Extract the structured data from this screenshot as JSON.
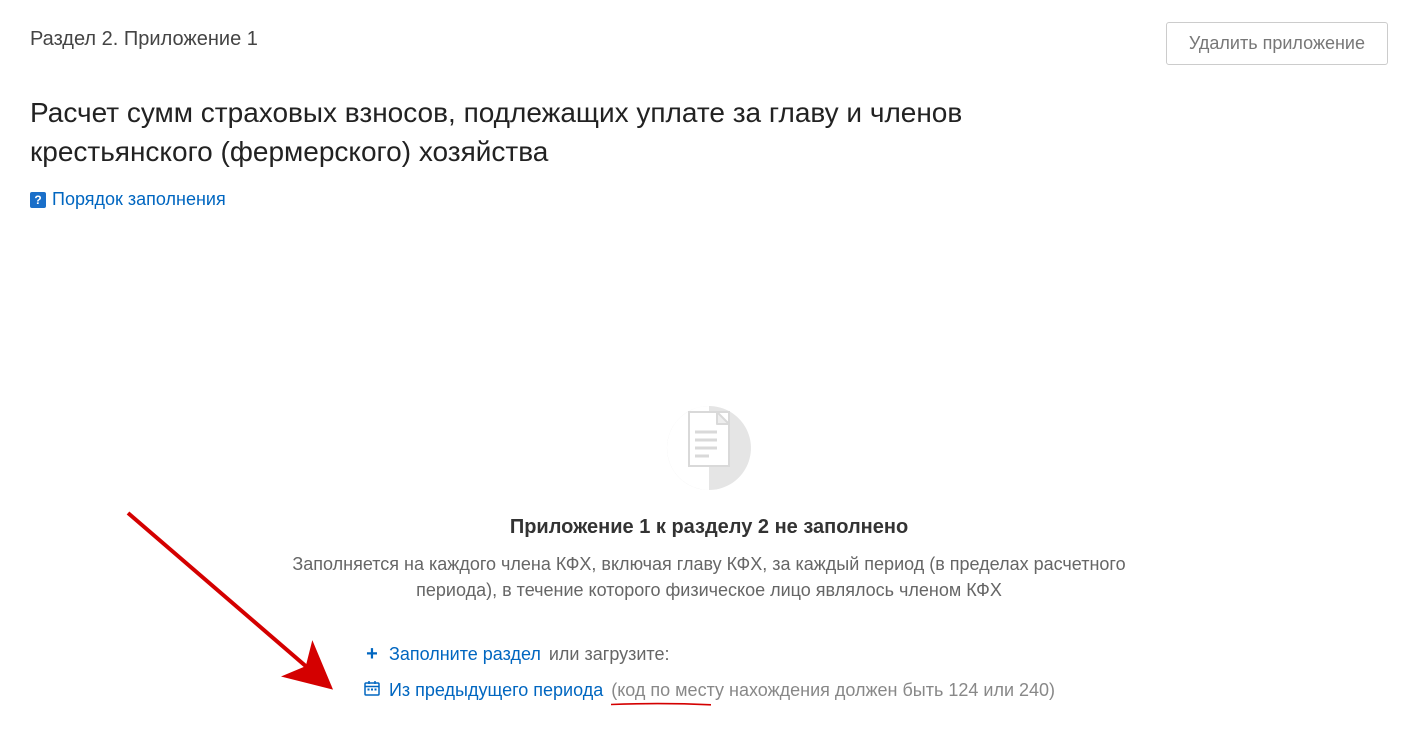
{
  "header": {
    "section_label": "Раздел 2. Приложение 1",
    "delete_button": "Удалить приложение",
    "title": "Расчет сумм страховых взносов, подлежащих уплате за главу и членов крестьянского (фермерского) хозяйства",
    "help_link": "Порядок заполнения"
  },
  "empty": {
    "title": "Приложение 1 к разделу 2 не заполнено",
    "description": "Заполняется на каждого члена КФХ, включая главу КФХ, за каждый период (в пределах расчетного периода), в течение которого физическое лицо являлось членом КФХ"
  },
  "actions": {
    "fill_link": "Заполните раздел",
    "fill_suffix": " или загрузите:",
    "prev_period_link": "Из предыдущего периода",
    "prev_period_note": "(код по месту нахождения должен быть 124 или 240)"
  }
}
